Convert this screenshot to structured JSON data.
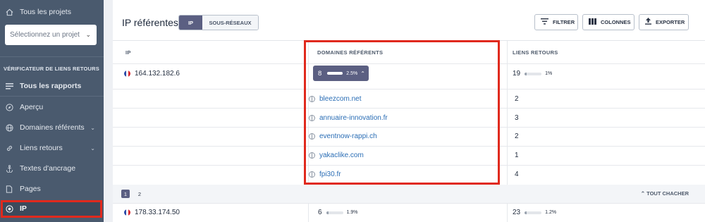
{
  "sidebar": {
    "all_projects": "Tous les projets",
    "project_select_placeholder": "Sélectionnez un projet",
    "section_title": "VÉRIFICATEUR DE LIENS RETOURS",
    "all_reports": "Tous les rapports",
    "items": [
      {
        "label": "Aperçu",
        "icon": "compass-icon"
      },
      {
        "label": "Domaines référents",
        "icon": "globe-icon"
      },
      {
        "label": "Liens retours",
        "icon": "link-icon"
      },
      {
        "label": "Textes d'ancrage",
        "icon": "anchor-icon"
      },
      {
        "label": "Pages",
        "icon": "page-icon"
      },
      {
        "label": "IP",
        "icon": "target-icon"
      }
    ]
  },
  "header": {
    "title": "IP référentes",
    "toggle": {
      "active": "IP",
      "inactive": "SOUS-RÉSEAUX"
    },
    "buttons": {
      "filter": "FILTRER",
      "columns": "COLONNES",
      "export": "EXPORTER"
    }
  },
  "table": {
    "columns": {
      "ip": "IP",
      "domains": "DOMAINES RÉFÉRENTS",
      "backlinks": "LIENS RETOURS"
    },
    "row1": {
      "ip": "164.132.182.6",
      "domains_count": "8",
      "domains_pct": "2.5%",
      "domains_fill": 0.9,
      "backlinks_count": "19",
      "backlinks_pct": "1%",
      "backlinks_fill": 0.1
    },
    "expanded": [
      {
        "domain": "bleezcom.net",
        "links": "2"
      },
      {
        "domain": "annuaire-innovation.fr",
        "links": "3"
      },
      {
        "domain": "eventnow-rappi.ch",
        "links": "2"
      },
      {
        "domain": "yakaclike.com",
        "links": "1"
      },
      {
        "domain": "fpi30.fr",
        "links": "4"
      }
    ],
    "pagination": {
      "pages": [
        "1",
        "2"
      ],
      "current": "1",
      "hide_all": "TOUT CHACHER"
    },
    "row2": {
      "ip": "178.33.174.50",
      "domains_count": "6",
      "domains_pct": "1.9%",
      "domains_fill": 0.1,
      "backlinks_count": "23",
      "backlinks_pct": "1.2%",
      "backlinks_fill": 0.1
    }
  },
  "colors": {
    "accent": "#5b5f82",
    "sidebar": "#4a5a6e",
    "highlight": "#e0291d",
    "link": "#2a6db5"
  }
}
